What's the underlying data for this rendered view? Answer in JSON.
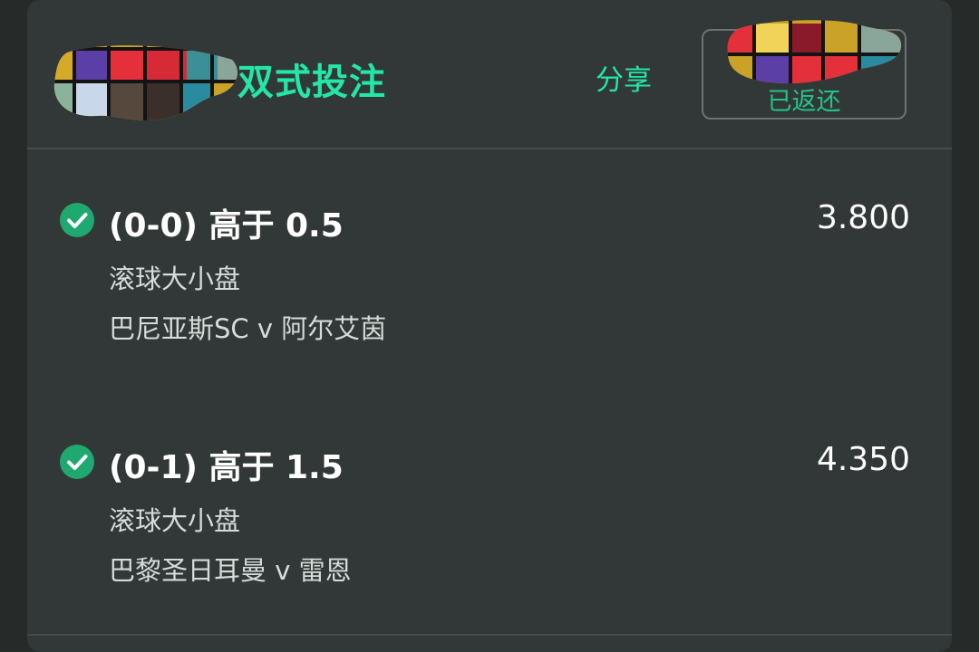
{
  "header": {
    "title": "双式投注",
    "share_label": "分享",
    "status_label": "已返还"
  },
  "selections": [
    {
      "title": "(0-0) 高于 0.5",
      "odds": "3.800",
      "market": "滚球大小盘",
      "match": "巴尼亚斯SC v 阿尔艾茵"
    },
    {
      "title": "(0-1) 高于 1.5",
      "odds": "4.350",
      "market": "滚球大小盘",
      "match": "巴黎圣日耳曼 v 雷恩"
    }
  ],
  "colors": {
    "accent": "#24e6a6",
    "check": "#1fa86f",
    "card_bg": "#323837",
    "page_bg": "#262a29"
  },
  "icons": {
    "selection_status": "check-circle-icon",
    "redaction": "redaction-mosaic"
  }
}
